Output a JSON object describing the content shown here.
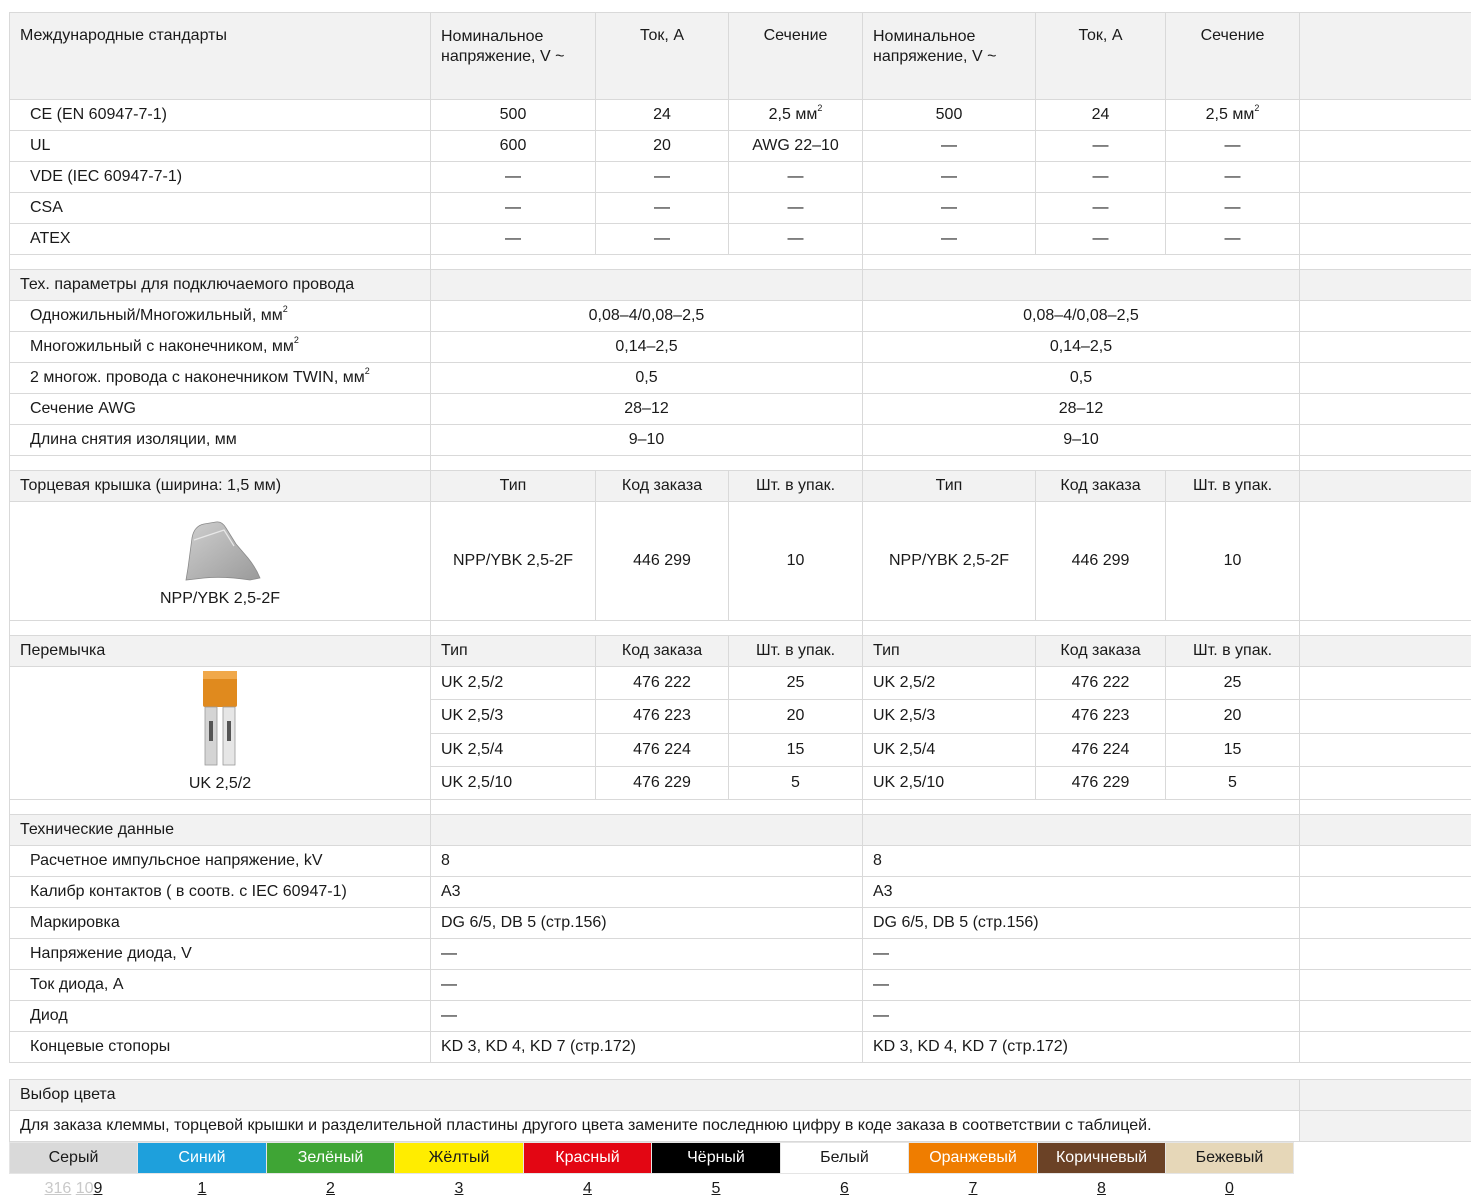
{
  "standards": {
    "title": "Международные стандарты",
    "cols": [
      "Номинальное напряжение, V ~",
      "Ток, А",
      "Сечение",
      "Номинальное напряжение, V ~",
      "Ток, А",
      "Сечение"
    ],
    "rows": [
      {
        "name": "CE (EN 60947-7-1)",
        "v1": "500",
        "a1": "24",
        "s1": "2,5 мм",
        "v2": "500",
        "a2": "24",
        "s2": "2,5 мм"
      },
      {
        "name": "UL",
        "v1": "600",
        "a1": "20",
        "s1": "AWG 22–10",
        "v2": "—",
        "a2": "—",
        "s2": "—"
      },
      {
        "name": "VDE (IEC 60947-7-1)",
        "v1": "—",
        "a1": "—",
        "s1": "—",
        "v2": "—",
        "a2": "—",
        "s2": "—"
      },
      {
        "name": "CSA",
        "v1": "—",
        "a1": "—",
        "s1": "—",
        "v2": "—",
        "a2": "—",
        "s2": "—"
      },
      {
        "name": "ATEX",
        "v1": "—",
        "a1": "—",
        "s1": "—",
        "v2": "—",
        "a2": "—",
        "s2": "—"
      }
    ]
  },
  "wire": {
    "title": "Тех. параметры для подключаемого провода",
    "sup": "2",
    "rows": [
      {
        "name": "Одножильный/Многожильный, мм",
        "v1": "0,08–4/0,08–2,5",
        "v2": "0,08–4/0,08–2,5"
      },
      {
        "name": "Многожильный с наконечником, мм",
        "v1": "0,14–2,5",
        "v2": "0,14–2,5"
      },
      {
        "name": "2 многож. провода с наконечником TWIN, мм",
        "v1": "0,5",
        "v2": "0,5"
      },
      {
        "name": "Сечение AWG",
        "v1": "28–12",
        "v2": "28–12"
      },
      {
        "name": "Длина снятия изоляции, мм",
        "v1": "9–10",
        "v2": "9–10"
      }
    ]
  },
  "endcap": {
    "title": "Торцевая крышка (ширина: 1,5 мм)",
    "cols": [
      "Тип",
      "Код заказа",
      "Шт. в упак.",
      "Тип",
      "Код заказа",
      "Шт. в упак."
    ],
    "image_caption": "NPP/YBK 2,5-2F",
    "type1": "NPP/YBK 2,5-2F",
    "code1": "446 299",
    "qty1": "10",
    "type2": "NPP/YBK 2,5-2F",
    "code2": "446 299",
    "qty2": "10"
  },
  "bridge": {
    "title": "Перемычка",
    "cols": [
      "Тип",
      "Код заказа",
      "Шт. в упак.",
      "Тип",
      "Код заказа",
      "Шт. в упак."
    ],
    "image_caption": "UK 2,5/2",
    "rows": [
      {
        "t1": "UK 2,5/2",
        "c1": "476 222",
        "q1": "25",
        "t2": "UK 2,5/2",
        "c2": "476 222",
        "q2": "25"
      },
      {
        "t1": "UK 2,5/3",
        "c1": "476 223",
        "q1": "20",
        "t2": "UK 2,5/3",
        "c2": "476 223",
        "q2": "20"
      },
      {
        "t1": "UK 2,5/4",
        "c1": "476 224",
        "q1": "15",
        "t2": "UK 2,5/4",
        "c2": "476 224",
        "q2": "15"
      },
      {
        "t1": "UK 2,5/10",
        "c1": "476 229",
        "q1": "5",
        "t2": "UK 2,5/10",
        "c2": "476 229",
        "q2": "5"
      }
    ]
  },
  "tech": {
    "title": "Технические данные",
    "rows": [
      {
        "name": "Расчетное импульсное напряжение, kV",
        "v1": "8",
        "v2": "8"
      },
      {
        "name": "Калибр контактов ( в соотв. с IEC 60947-1)",
        "v1": "А3",
        "v2": "А3"
      },
      {
        "name": "Маркировка",
        "v1": "DG 6/5, DB 5 (стр.156)",
        "v2": "DG 6/5, DB 5 (стр.156)"
      },
      {
        "name": "Напряжение диода, V",
        "v1": "—",
        "v2": "—"
      },
      {
        "name": "Ток диода, А",
        "v1": "—",
        "v2": "—"
      },
      {
        "name": "Диод",
        "v1": "—",
        "v2": "—"
      },
      {
        "name": "Концевые стопоры",
        "v1": "KD 3, KD 4, KD 7 (стр.172)",
        "v2": "KD 3, KD 4, KD 7 (стр.172)"
      }
    ]
  },
  "color": {
    "title": "Выбор цвета",
    "note": "Для заказа клеммы, торцевой крышки и разделительной пластины другого цвета замените последнюю цифру в коде заказа в соответствии с таблицей.",
    "faded_prefix": [
      "316",
      "10"
    ],
    "swatches": [
      {
        "name": "Серый",
        "code": "9",
        "bg": "#d9d9d9",
        "fg": "#1a1a1a"
      },
      {
        "name": "Синий",
        "code": "1",
        "bg": "#1ea0dc",
        "fg": "#ffffff"
      },
      {
        "name": "Зелёный",
        "code": "2",
        "bg": "#3fa535",
        "fg": "#ffffff"
      },
      {
        "name": "Жёлтый",
        "code": "3",
        "bg": "#ffed00",
        "fg": "#1a1a1a"
      },
      {
        "name": "Красный",
        "code": "4",
        "bg": "#e30613",
        "fg": "#ffffff"
      },
      {
        "name": "Чёрный",
        "code": "5",
        "bg": "#000000",
        "fg": "#ffffff"
      },
      {
        "name": "Белый",
        "code": "6",
        "bg": "#ffffff",
        "fg": "#1a1a1a"
      },
      {
        "name": "Оранжевый",
        "code": "7",
        "bg": "#ef7d00",
        "fg": "#ffffff"
      },
      {
        "name": "Коричневый",
        "code": "8",
        "bg": "#6b4226",
        "fg": "#ffffff"
      },
      {
        "name": "Бежевый",
        "code": "0",
        "bg": "#e6d7b8",
        "fg": "#1a1a1a"
      }
    ]
  }
}
